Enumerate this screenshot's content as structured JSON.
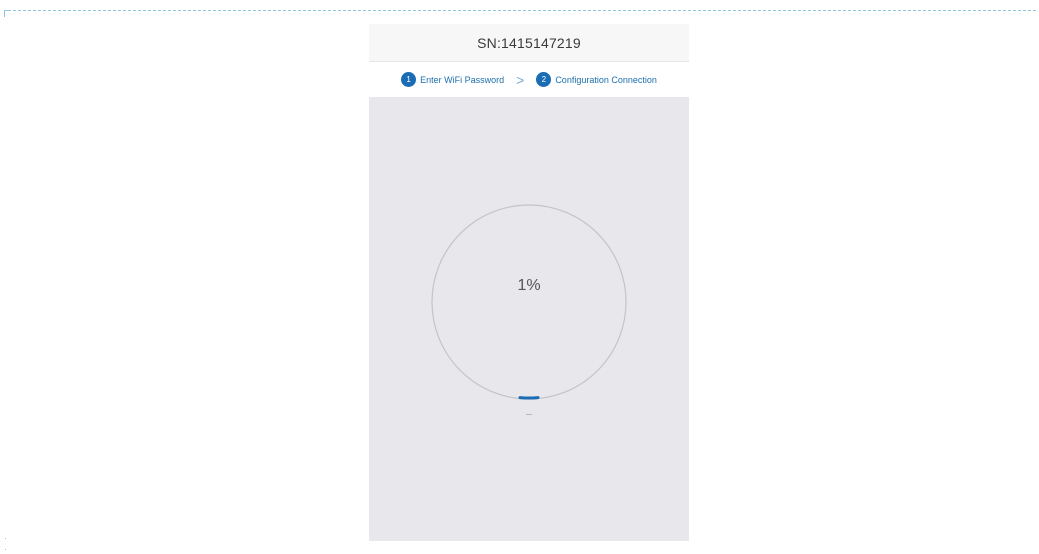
{
  "header": {
    "serial": "SN:1415147219"
  },
  "steps": [
    {
      "number": "1",
      "label": "Enter WiFi Password"
    },
    {
      "number": "2",
      "label": "Configuration Connection"
    }
  ],
  "step_separator": ">",
  "progress": {
    "percent_text": "1%",
    "value": 0.01
  },
  "colors": {
    "accent": "#1a6db5",
    "ring": "#c4c4c8",
    "background": "#e7e7ec"
  }
}
